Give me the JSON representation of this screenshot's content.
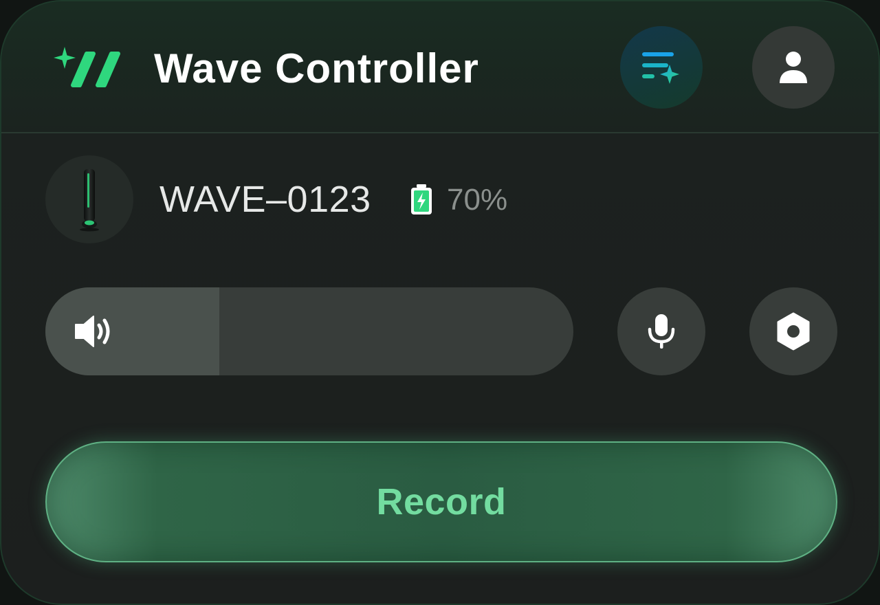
{
  "app": {
    "title": "Wave Controller"
  },
  "device": {
    "name": "WAVE–0123",
    "battery_text": "70%",
    "battery_level": 0.7
  },
  "volume": {
    "level": 0.33
  },
  "actions": {
    "record_label": "Record"
  },
  "icons": {
    "logo": "sparkle-slashes-logo",
    "queue": "queue-sparkle-icon",
    "profile": "user-icon",
    "battery": "battery-charging-icon",
    "volume": "speaker-icon",
    "mic": "microphone-icon",
    "settings": "hex-nut-settings-icon"
  },
  "colors": {
    "accent": "#2fd77e",
    "record_text": "#73dca0",
    "background": "#1c1f1e"
  }
}
